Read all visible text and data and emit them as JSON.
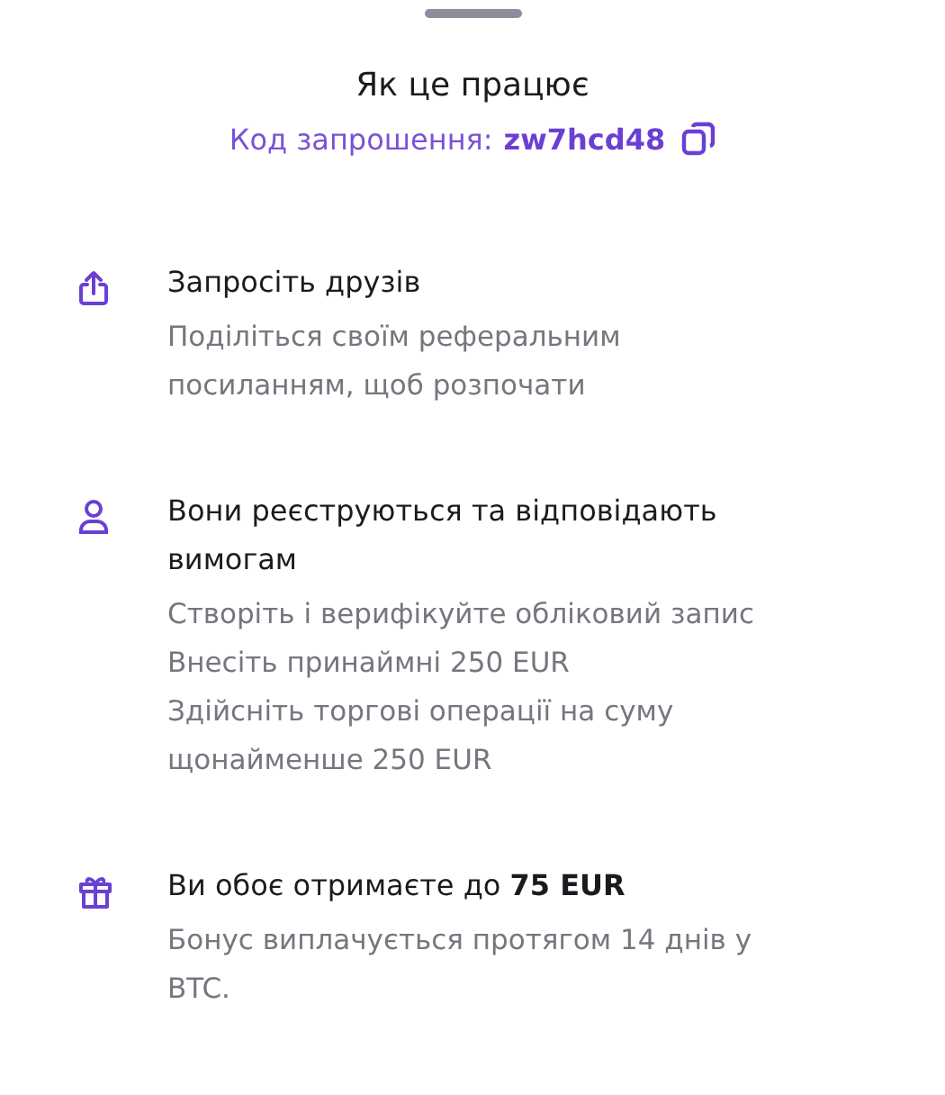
{
  "title": "Як це працює",
  "invite": {
    "label": "Код запрошення:",
    "code": "zw7hcd48"
  },
  "steps": [
    {
      "kind": "share",
      "title": "Запросіть друзів",
      "lines": [
        "Поділіться своїм реферальним посиланням, щоб розпочати"
      ]
    },
    {
      "kind": "user",
      "title": "Вони реєструються та відповідають вимогам",
      "lines": [
        "Створіть і верифікуйте обліковий запис",
        "Внесіть принаймні 250 EUR",
        "Здійсніть торгові операції на суму щонайменше 250 EUR"
      ]
    },
    {
      "kind": "gift",
      "title": "Ви обоє отримаєте до **75 EUR**",
      "lines": [
        "Бонус виплачується протягом 14 днів у BTC."
      ]
    }
  ]
}
